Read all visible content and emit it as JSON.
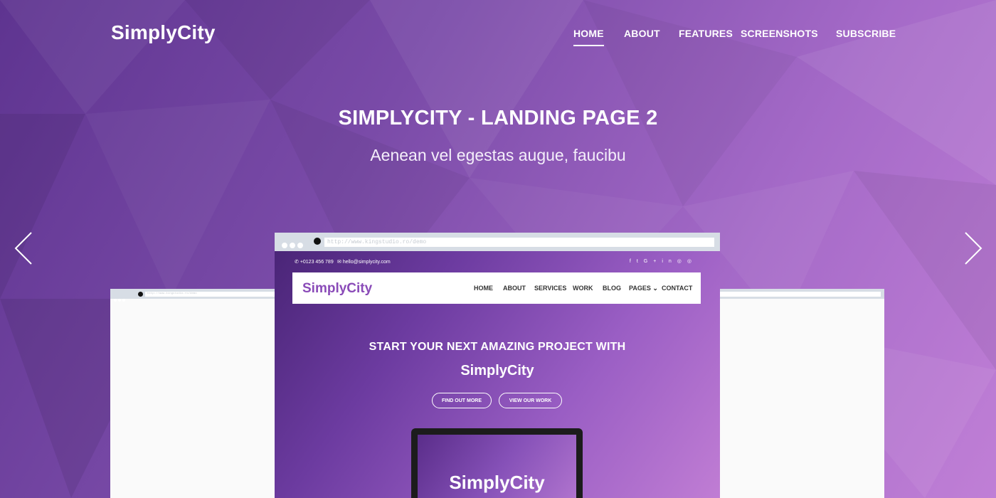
{
  "header": {
    "logo": "SimplyCity",
    "nav": [
      "HOME",
      "ABOUT",
      "FEATURES",
      "SCREENSHOTS",
      "SUBSCRIBE"
    ],
    "active_nav": "HOME"
  },
  "hero": {
    "title": "SIMPLYCITY - LANDING PAGE 2",
    "subtitle": "Aenean vel egestas augue, faucibu"
  },
  "slider": {
    "prev_icon": "chevron-left-icon",
    "next_icon": "chevron-right-icon"
  },
  "preview": {
    "url": "http://www.kingstudio.ro/demo",
    "phone": "+0123 456 789",
    "email": "hello@simplycity.com",
    "social_icons": [
      "f",
      "t",
      "G+",
      "in",
      "◎",
      "◎"
    ],
    "site_logo": "SimplyCity",
    "site_nav": [
      "HOME",
      "ABOUT",
      "SERVICES",
      "WORK",
      "BLOG",
      "PAGES",
      "CONTACT"
    ],
    "headline_1": "START YOUR NEXT AMAZING PROJECT WITH",
    "headline_2": "SimplyCity",
    "btn_primary": "FIND OUT MORE",
    "btn_secondary": "VIEW OUR WORK",
    "monitor_text": "SimplyCity"
  },
  "colors": {
    "accent": "#8a4bb8",
    "background_start": "#5e3490",
    "background_end": "#c07fd6"
  }
}
